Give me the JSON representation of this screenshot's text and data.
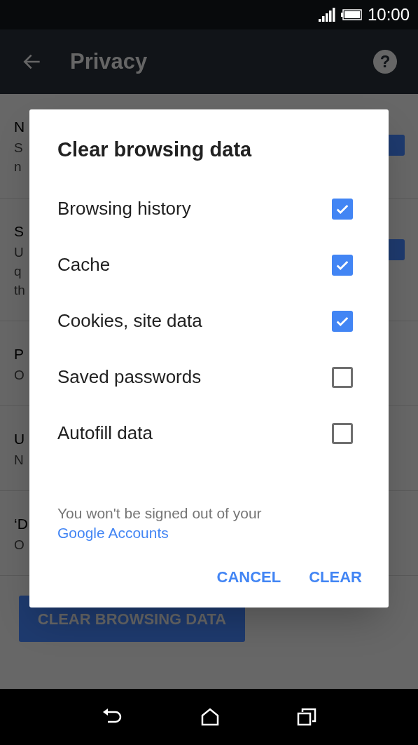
{
  "status_bar": {
    "time": "10:00"
  },
  "toolbar": {
    "title": "Privacy",
    "help": "?"
  },
  "settings_rows": [
    {
      "title": "N",
      "lines": [
        "S",
        "n"
      ],
      "checked": true
    },
    {
      "title": "S",
      "lines": [
        "U",
        "q",
        "th"
      ],
      "checked": true
    },
    {
      "title": "P",
      "lines": [
        "O"
      ]
    },
    {
      "title": "U",
      "lines": [
        "N"
      ]
    },
    {
      "title": "‘D",
      "lines": [
        "O"
      ]
    }
  ],
  "page_button": "CLEAR BROWSING DATA",
  "dialog": {
    "title": "Clear browsing data",
    "options": [
      {
        "label": "Browsing history",
        "checked": true
      },
      {
        "label": "Cache",
        "checked": true
      },
      {
        "label": "Cookies, site data",
        "checked": true
      },
      {
        "label": "Saved passwords",
        "checked": false
      },
      {
        "label": "Autofill data",
        "checked": false
      }
    ],
    "note": "You won't be signed out of your ",
    "note_link": "Google Accounts",
    "buttons": [
      "CANCEL",
      "CLEAR"
    ]
  }
}
